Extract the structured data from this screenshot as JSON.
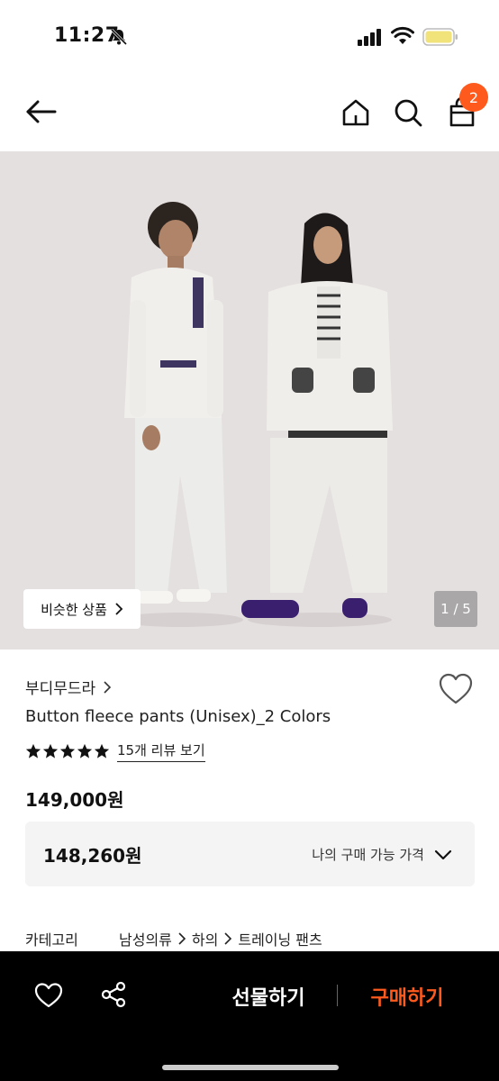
{
  "status_bar": {
    "time": "11:27"
  },
  "nav": {
    "cart_badge": "2"
  },
  "gallery": {
    "similar_label": "비슷한 상품",
    "page_indicator": "1 / 5"
  },
  "product": {
    "brand": "부디무드라",
    "name": "Button fleece pants (Unisex)_2 Colors",
    "rating_stars": 5,
    "review_link": "15개 리뷰 보기",
    "price": "149,000원",
    "my_price": "148,260원",
    "my_price_label": "나의 구매 가능 가격"
  },
  "category": {
    "label": "카테고리",
    "path": [
      "남성의류",
      "하의",
      "트레이닝 팬츠"
    ]
  },
  "bottom_bar": {
    "gift_label": "선물하기",
    "buy_label": "구매하기"
  },
  "colors": {
    "accent": "#fe5a1d",
    "bar": "#000000",
    "image_bg": "#e5e0e0"
  }
}
